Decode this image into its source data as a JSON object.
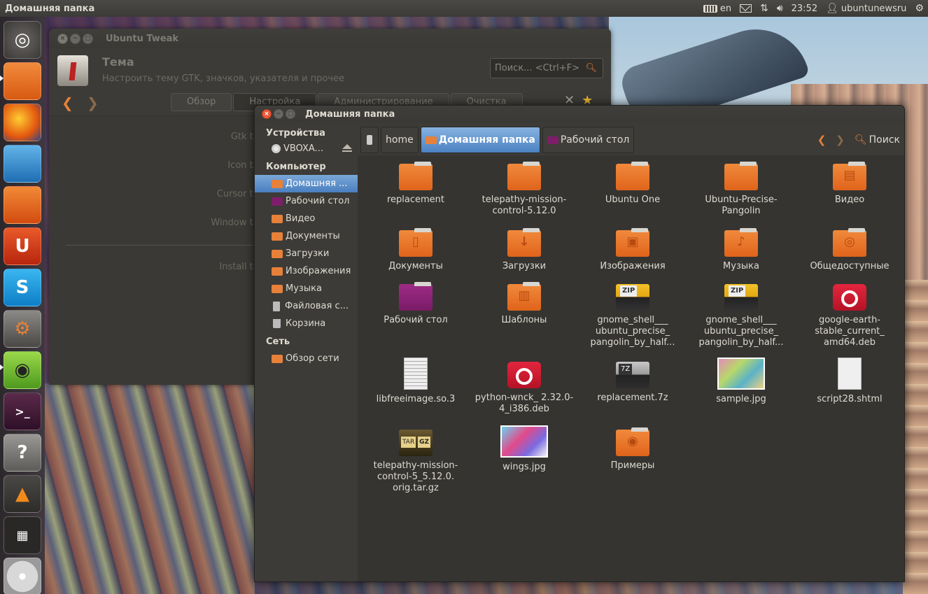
{
  "top_panel": {
    "title": "Домашняя папка",
    "lang": "en",
    "time": "23:52",
    "user": "ubuntunewsru"
  },
  "launcher": {
    "items": [
      "ubuntu-logo-icon",
      "home-folder-icon",
      "firefox-icon",
      "libreoffice-writer-icon",
      "ubuntu-software-center-icon",
      "ubuntu-one-icon",
      "skype-icon",
      "system-settings-icon",
      "ubuntu-tweak-icon",
      "terminal-icon",
      "help-icon",
      "vlc-icon",
      "workspace-switcher-icon",
      "dvd-icon"
    ]
  },
  "tweak": {
    "title": "Ubuntu Tweak",
    "heading": "Тема",
    "description": "Настроить тему GTK, значков, указателя и прочее",
    "search_placeholder": "Поиск... <Ctrl+F>",
    "tabs": [
      "Обзор",
      "Настройка",
      "Администрирование",
      "Очистка"
    ],
    "labels": [
      "Gtk th",
      "Icon th",
      "Cursor th",
      "Window th",
      "Install th"
    ]
  },
  "nautilus": {
    "title": "Домашняя папка",
    "sidebar": {
      "devices_header": "Устройства",
      "devices": [
        {
          "label": "VBOXA..."
        }
      ],
      "computer_header": "Компьютер",
      "computer": [
        {
          "label": "Домашняя ...",
          "selected": true
        },
        {
          "label": "Рабочий стол"
        },
        {
          "label": "Видео"
        },
        {
          "label": "Документы"
        },
        {
          "label": "Загрузки"
        },
        {
          "label": "Изображения"
        },
        {
          "label": "Музыка"
        },
        {
          "label": "Файловая с..."
        },
        {
          "label": "Корзина"
        }
      ],
      "network_header": "Сеть",
      "network": [
        {
          "label": "Обзор сети"
        }
      ]
    },
    "breadcrumbs": [
      "home",
      "Домашняя папка",
      "Рабочий стол"
    ],
    "search_label": "Поиск",
    "files": [
      {
        "name": "replacement",
        "icon": "folder"
      },
      {
        "name": "telepathy-mission-control-5.12.0",
        "icon": "folder"
      },
      {
        "name": "Ubuntu One",
        "icon": "folder"
      },
      {
        "name": "Ubuntu-Precise-Pangolin",
        "icon": "folder"
      },
      {
        "name": "Видео",
        "icon": "folder-videos"
      },
      {
        "name": "Документы",
        "icon": "folder-documents"
      },
      {
        "name": "Загрузки",
        "icon": "folder-downloads"
      },
      {
        "name": "Изображения",
        "icon": "folder-pictures"
      },
      {
        "name": "Музыка",
        "icon": "folder-music"
      },
      {
        "name": "Общедоступные",
        "icon": "folder-public"
      },
      {
        "name": "Рабочий стол",
        "icon": "folder-desktop"
      },
      {
        "name": "Шаблоны",
        "icon": "folder-templates"
      },
      {
        "name": "gnome_shell___ ubuntu_precise_ pangolin_by_half...",
        "icon": "zip"
      },
      {
        "name": "gnome_shell___ ubuntu_precise_ pangolin_by_half...",
        "icon": "zip"
      },
      {
        "name": "google-earth-stable_current_ amd64.deb",
        "icon": "deb"
      },
      {
        "name": "libfreeimage.so.3",
        "icon": "binary"
      },
      {
        "name": "python-wnck_ 2.32.0-4_i386.deb",
        "icon": "deb"
      },
      {
        "name": "replacement.7z",
        "icon": "7z"
      },
      {
        "name": "sample.jpg",
        "icon": "image"
      },
      {
        "name": "script28.shtml",
        "icon": "text"
      },
      {
        "name": "telepathy-mission-control-5_5.12.0. orig.tar.gz",
        "icon": "targz"
      },
      {
        "name": "wings.jpg",
        "icon": "image"
      },
      {
        "name": "Примеры",
        "icon": "folder-examples"
      }
    ]
  }
}
